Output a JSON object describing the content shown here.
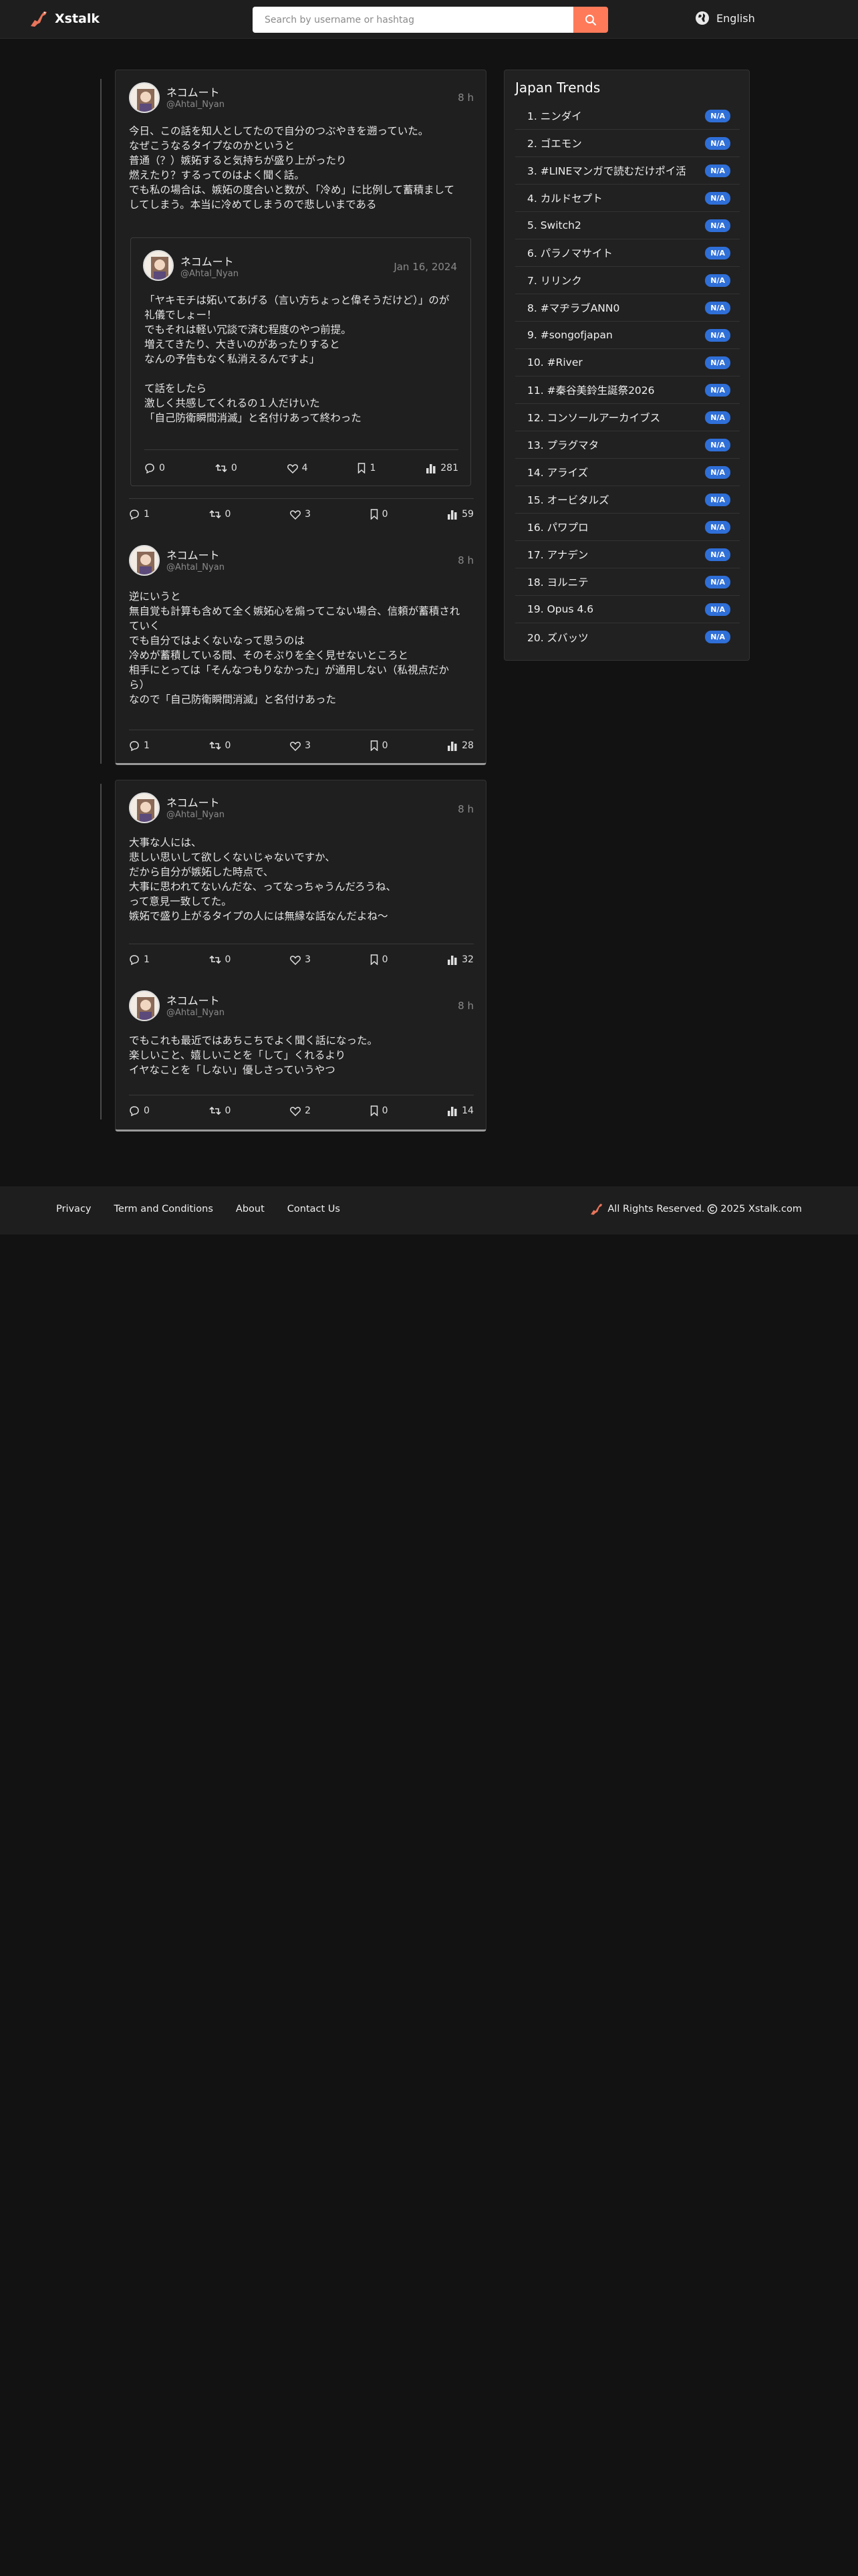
{
  "header": {
    "logo_text": "Xstalk",
    "search_placeholder": "Search by username or hashtag",
    "language": "English"
  },
  "thread1": {
    "post1": {
      "name": "ネコムート",
      "handle": "@Ahtal_Nyan",
      "time": "8 h",
      "text": "今日、この話を知人としてたので自分のつぶやきを遡っていた。\nなぜこうなるタイプなのかというと\n普通（？）嫉妬すると気持ちが盛り上がったり\n燃えたり？するってのはよく聞く話。\nでも私の場合は、嫉妬の度合いと数が、「冷め」に比例して蓄積まして\nしてしまう。本当に冷めてしまうので悲しいまである",
      "quote": {
        "name": "ネコムート",
        "handle": "@Ahtal_Nyan",
        "time": "Jan 16, 2024",
        "text": "「ヤキモチは妬いてあげる（言い方ちょっと偉そうだけど）」のが\n礼儀でしょー！\nでもそれは軽い冗談で済む程度のやつ前提。\n増えてきたり、大きいのがあったりすると\nなんの予告もなく私消えるんですよ」\n\nて話をしたら\n激しく共感してくれるの１人だけいた\n「自己防衛瞬間消滅」と名付けあって終わった",
        "replies": "0",
        "reposts": "0",
        "likes": "4",
        "bookmarks": "1",
        "views": "281"
      },
      "replies": "1",
      "reposts": "0",
      "likes": "3",
      "bookmarks": "0",
      "views": "59"
    },
    "post2": {
      "name": "ネコムート",
      "handle": "@Ahtal_Nyan",
      "time": "8 h",
      "text": "逆にいうと\n無自覚も計算も含めて全く嫉妬心を煽ってこない場合、信頼が蓄積され\nていく\nでも自分ではよくないなって思うのは\n冷めが蓄積している間、そのそぶりを全く見せないところと\n相手にとっては「そんなつもりなかった」が通用しない（私視点だか\nら）\nなので「自己防衛瞬間消滅」と名付けあった",
      "replies": "1",
      "reposts": "0",
      "likes": "3",
      "bookmarks": "0",
      "views": "28"
    }
  },
  "thread2": {
    "post1": {
      "name": "ネコムート",
      "handle": "@Ahtal_Nyan",
      "time": "8 h",
      "text": "大事な人には、\n悲しい思いして欲しくないじゃないですか、\nだから自分が嫉妬した時点で、\n大事に思われてないんだな、ってなっちゃうんだろうね、\nって意見一致してた。\n嫉妬で盛り上がるタイプの人には無縁な話なんだよね〜",
      "replies": "1",
      "reposts": "0",
      "likes": "3",
      "bookmarks": "0",
      "views": "32"
    },
    "post2": {
      "name": "ネコムート",
      "handle": "@Ahtal_Nyan",
      "time": "8 h",
      "text": "でもこれも最近ではあちこちでよく聞く話になった。\n楽しいこと、嬉しいことを「して」くれるより\nイヤなことを「しない」優しさっていうやつ",
      "replies": "0",
      "reposts": "0",
      "likes": "2",
      "bookmarks": "0",
      "views": "14"
    }
  },
  "trends": {
    "title": "Japan Trends",
    "badge": "N/A",
    "items": [
      "1. ニンダイ",
      "2. ゴエモン",
      "3. #LINEマンガで読むだけポイ活",
      "4. カルドセプト",
      "5. Switch2",
      "6. パラノマサイト",
      "7. リリンク",
      "8. #マヂラブANN0",
      "9. #songofjapan",
      "10. #River",
      "11. #秦谷美鈴生誕祭2026",
      "12. コンソールアーカイブス",
      "13. プラグマタ",
      "14. アライズ",
      "15. オービタルズ",
      "16. パワプロ",
      "17. アナデン",
      "18. ヨルニテ",
      "19. Opus 4.6",
      "20. ズバッツ"
    ]
  },
  "footer": {
    "links": [
      "Privacy",
      "Term and Conditions",
      "About",
      "Contact Us"
    ],
    "rights": "All Rights Reserved.",
    "copyright": "2025 Xstalk.com"
  },
  "colors": {
    "background": "#121212",
    "accent": "#ff7a59",
    "badge": "#2f6fd8"
  }
}
